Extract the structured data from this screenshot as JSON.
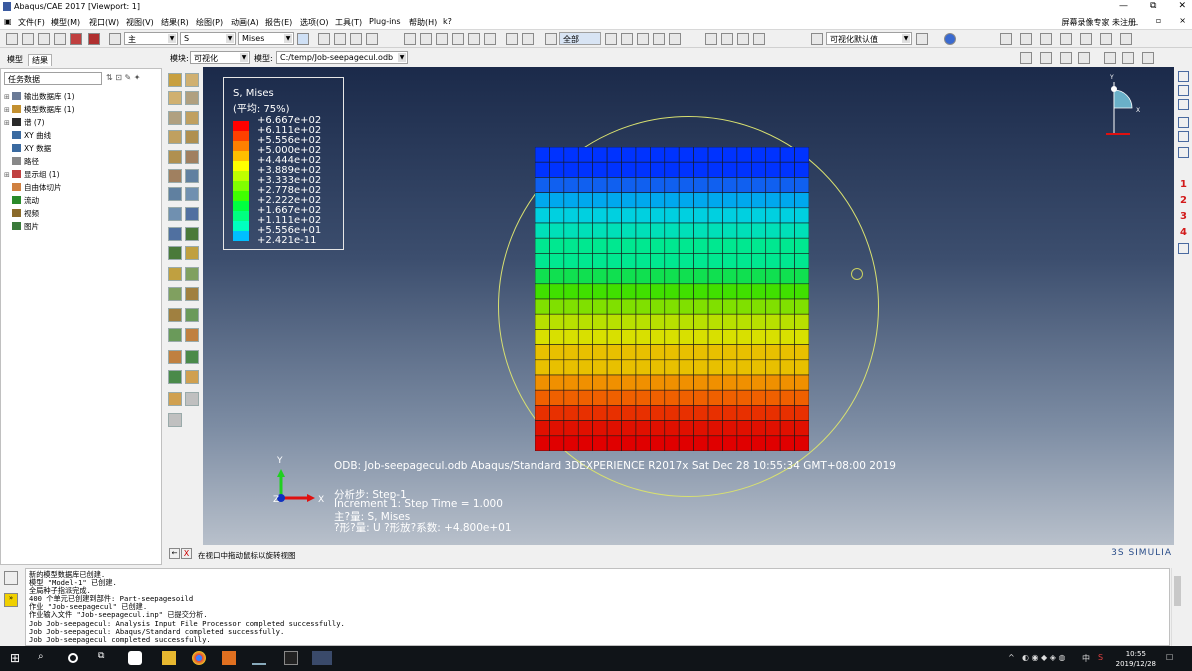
{
  "window": {
    "title": "Abaqus/CAE 2017 [Viewport: 1]",
    "min": "—",
    "max": "⧉",
    "close": "✕"
  },
  "menu": {
    "items": [
      "文件(F)",
      "模型(M)",
      "视口(W)",
      "视图(V)",
      "结果(R)",
      "绘图(P)",
      "动画(A)",
      "报告(E)",
      "选项(O)",
      "工具(T)",
      "Plug-ins",
      "帮助(H)",
      "k?"
    ],
    "user": "屏幕录像专家 未注册",
    "mdi": [
      "_",
      "▫",
      "×"
    ]
  },
  "toolbar1": {
    "step_select": "主",
    "var_select": "S",
    "comp_select": "Mises",
    "display_select": "全部",
    "mode_select": "可视化默认值"
  },
  "toolbar2": {
    "module_label": "模块:",
    "module_value": "可视化",
    "model_label": "模型:",
    "model_value": "C:/temp/Job-seepagecul.odb"
  },
  "tabs": [
    "模型",
    "结果"
  ],
  "leftpanel": {
    "filter": "任务数据",
    "tree": [
      {
        "label": "输出数据库 (1)",
        "expand": "⊞",
        "color": "#6a7a96"
      },
      {
        "label": "模型数据库 (1)",
        "expand": "⊞",
        "color": "#c39030"
      },
      {
        "label": "谱 (7)",
        "expand": "⊞",
        "color": "#2a2a2a"
      },
      {
        "label": "XY 曲线",
        "expand": "",
        "color": "#3a6aa0"
      },
      {
        "label": "XY 数据",
        "expand": "",
        "color": "#3a6aa0"
      },
      {
        "label": "路径",
        "expand": "",
        "color": "#888888"
      },
      {
        "label": "显示组 (1)",
        "expand": "⊞",
        "color": "#c04040"
      },
      {
        "label": "自由体切片",
        "expand": "",
        "color": "#d08040"
      },
      {
        "label": "流动",
        "expand": "",
        "color": "#2a8a2a"
      },
      {
        "label": "视频",
        "expand": "",
        "color": "#8a6a2a"
      },
      {
        "label": "图片",
        "expand": "",
        "color": "#3a7a3a"
      }
    ]
  },
  "legend": {
    "title": "S, Mises",
    "subtitle": "(平均: 75%)",
    "values": [
      "+6.667e+02",
      "+6.111e+02",
      "+5.556e+02",
      "+5.000e+02",
      "+4.444e+02",
      "+3.889e+02",
      "+3.333e+02",
      "+2.778e+02",
      "+2.222e+02",
      "+1.667e+02",
      "+1.111e+02",
      "+5.556e+01",
      "+2.421e-11"
    ],
    "colors": [
      "#ff0000",
      "#ff4000",
      "#ff8000",
      "#ffbf00",
      "#ffff00",
      "#bfff00",
      "#80ff00",
      "#40ff00",
      "#00ff40",
      "#00ff80",
      "#00ffbf",
      "#00bfff",
      "#0040ff"
    ]
  },
  "mesh": {
    "cols": 19,
    "rows": 20,
    "band_colors": [
      "#0033ff",
      "#1060f0",
      "#00a8ee",
      "#00d0e0",
      "#00e0b8",
      "#00e890",
      "#10e050",
      "#40e000",
      "#80e000",
      "#b8e000",
      "#d8e000",
      "#e8c000",
      "#f09000",
      "#f06000",
      "#e83000",
      "#e01000",
      "#e00000"
    ]
  },
  "info": {
    "odb": "ODB: Job-seepagecul.odb    Abaqus/Standard 3DEXPERIENCE R2017x    Sat Dec 28 10:55:34 GMT+08:00 2019",
    "step": "分析步: Step-1",
    "increment": "Increment      1: Step Time =      1.000",
    "primary": "主?量: S, Mises",
    "deformed": "?形?量: U   ?形放?系数: +4.800e+01"
  },
  "triad": {
    "y": "Y",
    "z": "Z",
    "x": "X"
  },
  "righttool": {
    "numbers": [
      "1",
      "2",
      "3",
      "4"
    ]
  },
  "prompt": {
    "text": "在视口中拖动鼠标以旋转视图",
    "cancel": "X"
  },
  "brand": "3S SIMULIA",
  "messages": [
    "新的模型数据库已创建.",
    "模型 \"Model-1\" 已创建.",
    "全局种子指派完成.",
    "400 个单元已创建到部件: Part-seepagesoild",
    "作业 \"Job-seepagecul\" 已创建.",
    "作业输入文件 \"Job-seepagecul.inp\" 已提交分析.",
    "Job Job-seepagecul: Analysis Input File Processor completed successfully.",
    "Job Job-seepagecul: Abaqus/Standard completed successfully.",
    "Job Job-seepagecul completed successfully."
  ],
  "taskbar": {
    "time": "10:55",
    "date": "2019/12/28",
    "ime": "中",
    "notify": "☐"
  },
  "colors": {
    "viewport_top": "#1b2a4a",
    "viewport_bottom": "#b8c0cb",
    "accent": "#2a4e8a"
  }
}
